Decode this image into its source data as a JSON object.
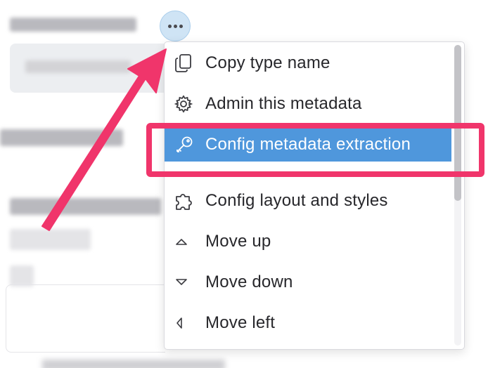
{
  "menu": {
    "items": [
      {
        "label": "Copy type name",
        "icon": "copy-icon"
      },
      {
        "label": "Admin this metadata",
        "icon": "gear-icon"
      },
      {
        "label": "Config metadata extraction",
        "icon": "key-icon",
        "active": true
      },
      {
        "label": "Config layout and styles",
        "icon": "puzzle-icon"
      },
      {
        "label": "Move up",
        "icon": "caret-up-icon"
      },
      {
        "label": "Move down",
        "icon": "caret-down-icon"
      },
      {
        "label": "Move left",
        "icon": "caret-left-icon"
      }
    ]
  },
  "colors": {
    "active_item": "#4f97dc",
    "highlight": "#f0356b",
    "more_button": "#cfe4f5"
  }
}
